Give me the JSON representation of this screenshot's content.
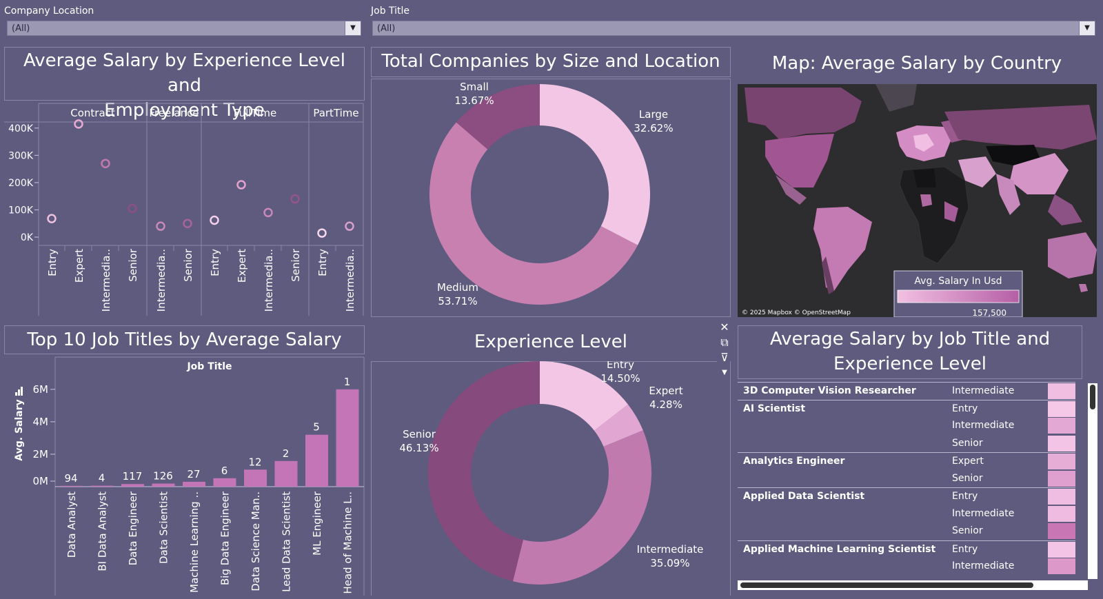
{
  "filters": {
    "company_location": {
      "label": "Company Location",
      "value": "(All)"
    },
    "job_title": {
      "label": "Job Title",
      "value": "(All)"
    }
  },
  "scatter": {
    "title_line1": "Average Salary by Experience Level and",
    "title_line2": "Employment Type",
    "groups": [
      "Contract",
      "Freelance",
      "FullTime",
      "PartTime"
    ],
    "y_ticks": [
      "400K",
      "300K",
      "200K",
      "100K",
      "0K"
    ],
    "chart_data": {
      "type": "scatter",
      "ylim": [
        0,
        450000
      ],
      "points": [
        {
          "group": "Contract",
          "level": "Entry",
          "value": 68000,
          "color": "#f0c0e0"
        },
        {
          "group": "Contract",
          "level": "Expert",
          "value": 415000,
          "color": "#e6acd2"
        },
        {
          "group": "Contract",
          "level": "Intermedia..",
          "value": 270000,
          "color": "#c17aae"
        },
        {
          "group": "Contract",
          "level": "Senior",
          "value": 105000,
          "color": "#8f4f84"
        },
        {
          "group": "Freelance",
          "level": "Intermedia..",
          "value": 40000,
          "color": "#c88ab8"
        },
        {
          "group": "Freelance",
          "level": "Senior",
          "value": 50000,
          "color": "#a5659a"
        },
        {
          "group": "FullTime",
          "level": "Entry",
          "value": 62000,
          "color": "#f5d0ec"
        },
        {
          "group": "FullTime",
          "level": "Expert",
          "value": 192000,
          "color": "#e2a3d0"
        },
        {
          "group": "FullTime",
          "level": "Intermedia..",
          "value": 90000,
          "color": "#c888ba"
        },
        {
          "group": "FullTime",
          "level": "Senior",
          "value": 140000,
          "color": "#955589"
        },
        {
          "group": "PartTime",
          "level": "Entry",
          "value": 15000,
          "color": "#f8d8ef"
        },
        {
          "group": "PartTime",
          "level": "Intermedia..",
          "value": 40000,
          "color": "#d9a0cc"
        }
      ]
    }
  },
  "donut_size": {
    "title": "Total Companies by Size and Location",
    "chart_data": {
      "type": "pie",
      "slices": [
        {
          "name": "Large",
          "pct": "32.62%",
          "value": 32.62,
          "color": "#f3c6e5"
        },
        {
          "name": "Medium",
          "pct": "53.71%",
          "value": 53.71,
          "color": "#c880b0"
        },
        {
          "name": "Small",
          "pct": "13.67%",
          "value": 13.67,
          "color": "#8c4d80"
        }
      ]
    }
  },
  "map": {
    "title": "Map: Average Salary by Country",
    "attribution": "© 2025 Mapbox © OpenStreetMap",
    "legend_title": "Avg. Salary In Usd",
    "legend_value": "157,500"
  },
  "top_jobs": {
    "title": "Top 10 Job Titles by Average Salary",
    "header": "Job Title",
    "ylabel": "Avg. Salary",
    "y_ticks": [
      "6M",
      "4M",
      "2M",
      "0M"
    ],
    "chart_data": {
      "type": "bar",
      "ylim": [
        0,
        6800000
      ],
      "categories": [
        "Data Analyst",
        "BI Data Analyst",
        "Data Engineer",
        "Data Scientist",
        "Machine Learning ..",
        "Big Data Engineer",
        "Data Science Man..",
        "Lead Data Scientist",
        "ML Engineer",
        "Head of Machine L.."
      ],
      "values": [
        50000,
        60000,
        160000,
        190000,
        300000,
        520000,
        1050000,
        1580000,
        3200000,
        6000000
      ],
      "labels": [
        "94",
        "4",
        "117",
        "126",
        "27",
        "6",
        "12",
        "2",
        "5",
        "1"
      ]
    }
  },
  "donut_exp": {
    "title": "Experience Level",
    "chart_data": {
      "type": "pie",
      "slices": [
        {
          "name": "Entry",
          "pct": "14.50%",
          "value": 14.5,
          "color": "#f3c6e5"
        },
        {
          "name": "Expert",
          "pct": "4.28%",
          "value": 4.28,
          "color": "#e2a6d3"
        },
        {
          "name": "Intermediate",
          "pct": "35.09%",
          "value": 35.09,
          "color": "#c07aae"
        },
        {
          "name": "Senior",
          "pct": "46.13%",
          "value": 46.13,
          "color": "#874a7c"
        }
      ]
    }
  },
  "table": {
    "title_line1": "Average Salary by Job Title and",
    "title_line2": "Experience Level",
    "rows": [
      {
        "title": "3D Computer Vision Researcher",
        "level": "Intermediate",
        "color": "#f0bee0"
      },
      {
        "title": "AI Scientist",
        "level": "Entry",
        "color": "#f5c8e8"
      },
      {
        "title": "",
        "level": "Intermediate",
        "color": "#e3a8d4"
      },
      {
        "title": "",
        "level": "Senior",
        "color": "#f3c4e5"
      },
      {
        "title": "Analytics Engineer",
        "level": "Expert",
        "color": "#e6aed6"
      },
      {
        "title": "",
        "level": "Senior",
        "color": "#e0a0cf"
      },
      {
        "title": "Applied Data Scientist",
        "level": "Entry",
        "color": "#f0bde2"
      },
      {
        "title": "",
        "level": "Intermediate",
        "color": "#efbbe1"
      },
      {
        "title": "",
        "level": "Senior",
        "color": "#c877b4"
      },
      {
        "title": "Applied Machine Learning Scientist",
        "level": "Entry",
        "color": "#f3c4e6"
      },
      {
        "title": "",
        "level": "Intermediate",
        "color": "#dc98c9"
      }
    ]
  }
}
